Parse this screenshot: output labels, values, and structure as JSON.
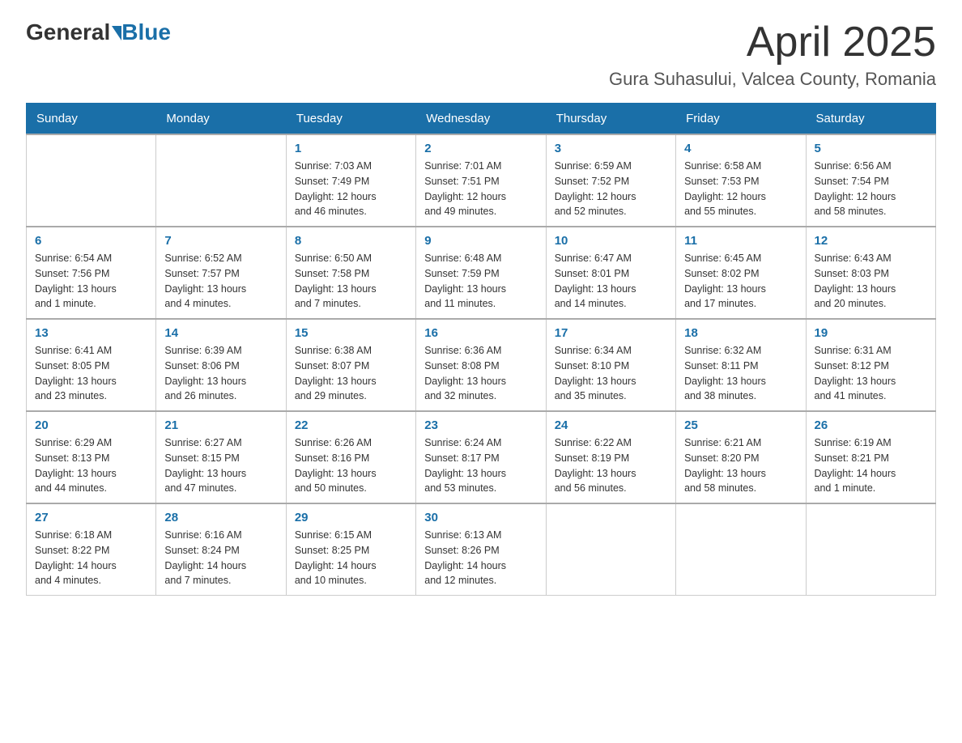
{
  "header": {
    "logo_general": "General",
    "logo_blue": "Blue",
    "month_title": "April 2025",
    "location": "Gura Suhasului, Valcea County, Romania"
  },
  "days_of_week": [
    "Sunday",
    "Monday",
    "Tuesday",
    "Wednesday",
    "Thursday",
    "Friday",
    "Saturday"
  ],
  "weeks": [
    [
      {
        "day": "",
        "info": ""
      },
      {
        "day": "",
        "info": ""
      },
      {
        "day": "1",
        "info": "Sunrise: 7:03 AM\nSunset: 7:49 PM\nDaylight: 12 hours\nand 46 minutes."
      },
      {
        "day": "2",
        "info": "Sunrise: 7:01 AM\nSunset: 7:51 PM\nDaylight: 12 hours\nand 49 minutes."
      },
      {
        "day": "3",
        "info": "Sunrise: 6:59 AM\nSunset: 7:52 PM\nDaylight: 12 hours\nand 52 minutes."
      },
      {
        "day": "4",
        "info": "Sunrise: 6:58 AM\nSunset: 7:53 PM\nDaylight: 12 hours\nand 55 minutes."
      },
      {
        "day": "5",
        "info": "Sunrise: 6:56 AM\nSunset: 7:54 PM\nDaylight: 12 hours\nand 58 minutes."
      }
    ],
    [
      {
        "day": "6",
        "info": "Sunrise: 6:54 AM\nSunset: 7:56 PM\nDaylight: 13 hours\nand 1 minute."
      },
      {
        "day": "7",
        "info": "Sunrise: 6:52 AM\nSunset: 7:57 PM\nDaylight: 13 hours\nand 4 minutes."
      },
      {
        "day": "8",
        "info": "Sunrise: 6:50 AM\nSunset: 7:58 PM\nDaylight: 13 hours\nand 7 minutes."
      },
      {
        "day": "9",
        "info": "Sunrise: 6:48 AM\nSunset: 7:59 PM\nDaylight: 13 hours\nand 11 minutes."
      },
      {
        "day": "10",
        "info": "Sunrise: 6:47 AM\nSunset: 8:01 PM\nDaylight: 13 hours\nand 14 minutes."
      },
      {
        "day": "11",
        "info": "Sunrise: 6:45 AM\nSunset: 8:02 PM\nDaylight: 13 hours\nand 17 minutes."
      },
      {
        "day": "12",
        "info": "Sunrise: 6:43 AM\nSunset: 8:03 PM\nDaylight: 13 hours\nand 20 minutes."
      }
    ],
    [
      {
        "day": "13",
        "info": "Sunrise: 6:41 AM\nSunset: 8:05 PM\nDaylight: 13 hours\nand 23 minutes."
      },
      {
        "day": "14",
        "info": "Sunrise: 6:39 AM\nSunset: 8:06 PM\nDaylight: 13 hours\nand 26 minutes."
      },
      {
        "day": "15",
        "info": "Sunrise: 6:38 AM\nSunset: 8:07 PM\nDaylight: 13 hours\nand 29 minutes."
      },
      {
        "day": "16",
        "info": "Sunrise: 6:36 AM\nSunset: 8:08 PM\nDaylight: 13 hours\nand 32 minutes."
      },
      {
        "day": "17",
        "info": "Sunrise: 6:34 AM\nSunset: 8:10 PM\nDaylight: 13 hours\nand 35 minutes."
      },
      {
        "day": "18",
        "info": "Sunrise: 6:32 AM\nSunset: 8:11 PM\nDaylight: 13 hours\nand 38 minutes."
      },
      {
        "day": "19",
        "info": "Sunrise: 6:31 AM\nSunset: 8:12 PM\nDaylight: 13 hours\nand 41 minutes."
      }
    ],
    [
      {
        "day": "20",
        "info": "Sunrise: 6:29 AM\nSunset: 8:13 PM\nDaylight: 13 hours\nand 44 minutes."
      },
      {
        "day": "21",
        "info": "Sunrise: 6:27 AM\nSunset: 8:15 PM\nDaylight: 13 hours\nand 47 minutes."
      },
      {
        "day": "22",
        "info": "Sunrise: 6:26 AM\nSunset: 8:16 PM\nDaylight: 13 hours\nand 50 minutes."
      },
      {
        "day": "23",
        "info": "Sunrise: 6:24 AM\nSunset: 8:17 PM\nDaylight: 13 hours\nand 53 minutes."
      },
      {
        "day": "24",
        "info": "Sunrise: 6:22 AM\nSunset: 8:19 PM\nDaylight: 13 hours\nand 56 minutes."
      },
      {
        "day": "25",
        "info": "Sunrise: 6:21 AM\nSunset: 8:20 PM\nDaylight: 13 hours\nand 58 minutes."
      },
      {
        "day": "26",
        "info": "Sunrise: 6:19 AM\nSunset: 8:21 PM\nDaylight: 14 hours\nand 1 minute."
      }
    ],
    [
      {
        "day": "27",
        "info": "Sunrise: 6:18 AM\nSunset: 8:22 PM\nDaylight: 14 hours\nand 4 minutes."
      },
      {
        "day": "28",
        "info": "Sunrise: 6:16 AM\nSunset: 8:24 PM\nDaylight: 14 hours\nand 7 minutes."
      },
      {
        "day": "29",
        "info": "Sunrise: 6:15 AM\nSunset: 8:25 PM\nDaylight: 14 hours\nand 10 minutes."
      },
      {
        "day": "30",
        "info": "Sunrise: 6:13 AM\nSunset: 8:26 PM\nDaylight: 14 hours\nand 12 minutes."
      },
      {
        "day": "",
        "info": ""
      },
      {
        "day": "",
        "info": ""
      },
      {
        "day": "",
        "info": ""
      }
    ]
  ]
}
